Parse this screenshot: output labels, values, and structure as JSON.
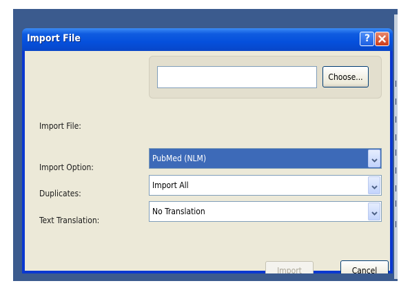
{
  "window": {
    "title": "Import File",
    "help_icon": "help-icon",
    "close_icon": "close-icon"
  },
  "form": {
    "import_file": {
      "label": "Import File:",
      "value": "",
      "choose_label": "Choose..."
    },
    "import_option": {
      "label": "Import Option:",
      "value": "PubMed (NLM)",
      "highlighted": true
    },
    "duplicates": {
      "label": "Duplicates:",
      "value": "Import All"
    },
    "text_translation": {
      "label": "Text Translation:",
      "value": "No Translation"
    }
  },
  "buttons": {
    "import_label": "Import",
    "import_enabled": false,
    "cancel_label": "Cancel"
  },
  "colors": {
    "titlebar": "#0550dc",
    "client": "#ece9d8",
    "selection": "#3d6ab8",
    "close_button": "#cc3b18"
  }
}
